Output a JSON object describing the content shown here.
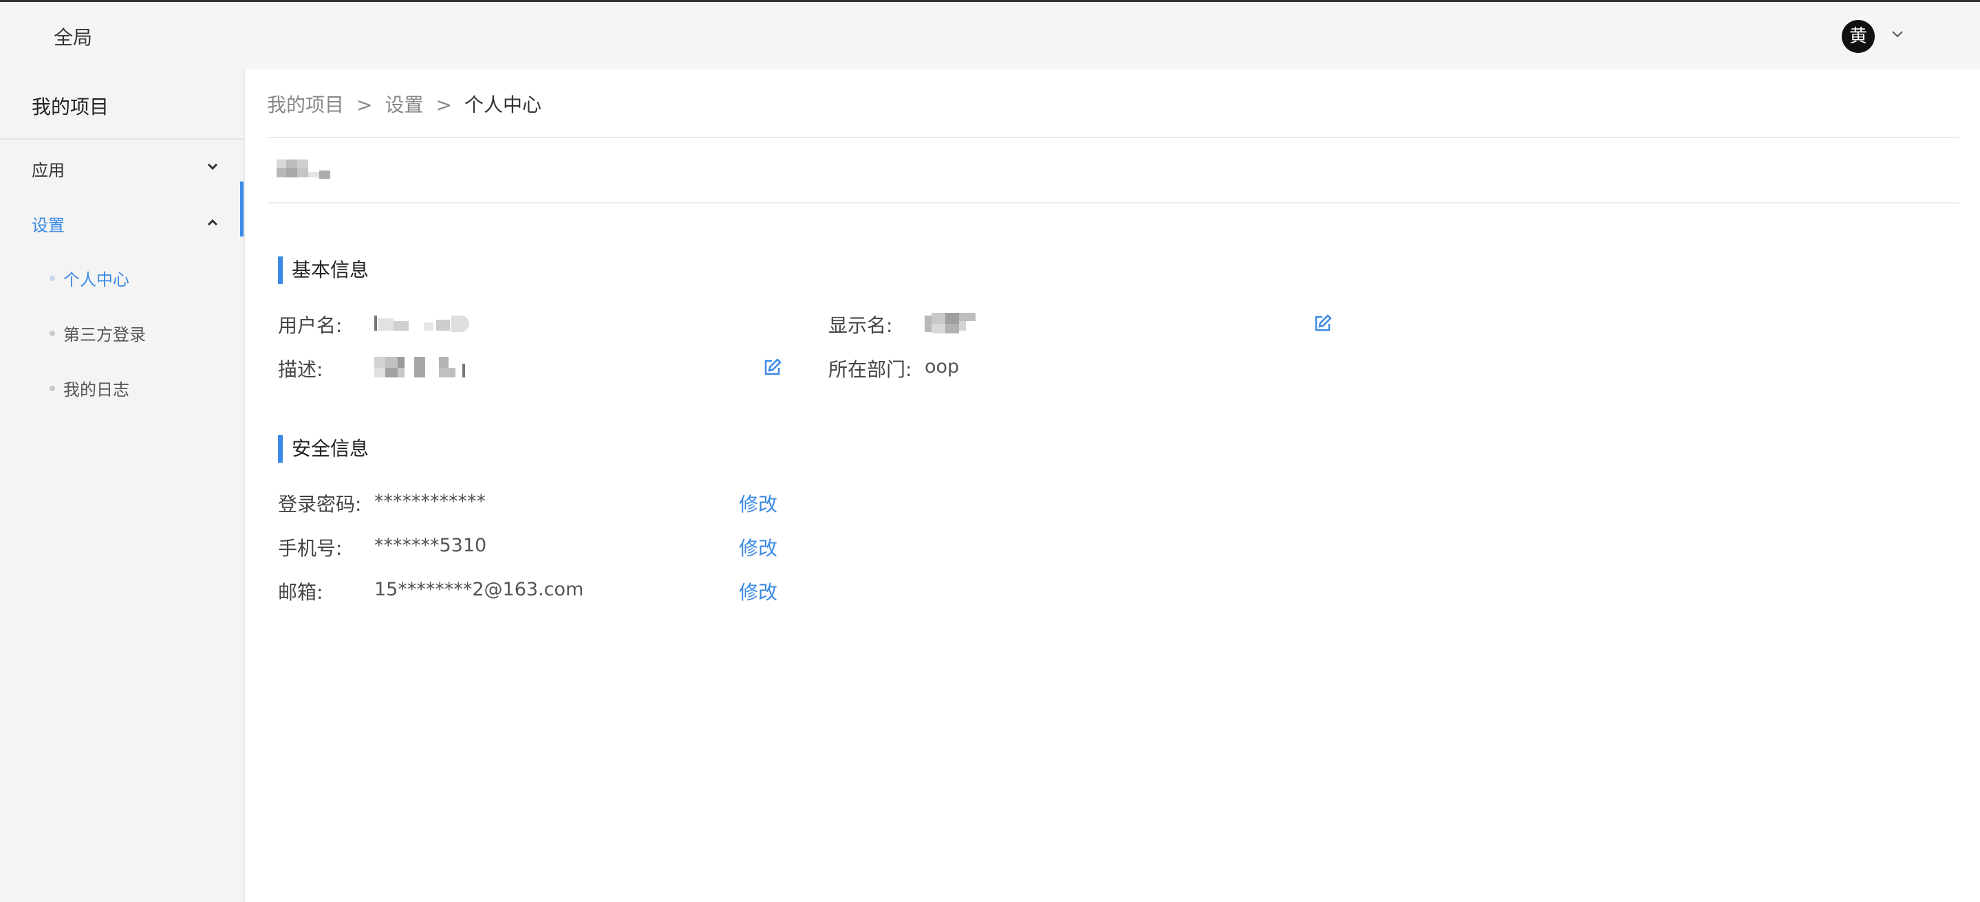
{
  "header": {
    "global_label": "全局",
    "avatar_text": "黄",
    "avatar_bg": "#111111"
  },
  "sidebar": {
    "title": "我的项目",
    "menus": [
      {
        "label": "应用",
        "expanded": false,
        "icon": "chevron-down-icon"
      },
      {
        "label": "设置",
        "expanded": true,
        "icon": "chevron-up-icon"
      }
    ],
    "sub_items": [
      {
        "label": "个人中心",
        "active": true
      },
      {
        "label": "第三方登录",
        "active": false
      },
      {
        "label": "我的日志",
        "active": false
      }
    ]
  },
  "breadcrumb": {
    "items": [
      "我的项目",
      "设置",
      "个人中心"
    ],
    "separator": ">"
  },
  "basic_info": {
    "title": "基本信息",
    "username_label": "用户名:",
    "display_name_label": "显示名:",
    "description_label": "描述:",
    "department_label": "所在部门:",
    "department_value": "oop"
  },
  "security_info": {
    "title": "安全信息",
    "password_label": "登录密码:",
    "password_value": "************",
    "phone_label": "手机号:",
    "phone_value": "*******5310",
    "email_label": "邮箱:",
    "email_value": "15********2@163.com",
    "modify_label": "修改"
  },
  "colors": {
    "accent": "#3b8ae6",
    "sidebar_bg": "#f4f4f4",
    "topbar_bg": "#f5f5f5"
  }
}
